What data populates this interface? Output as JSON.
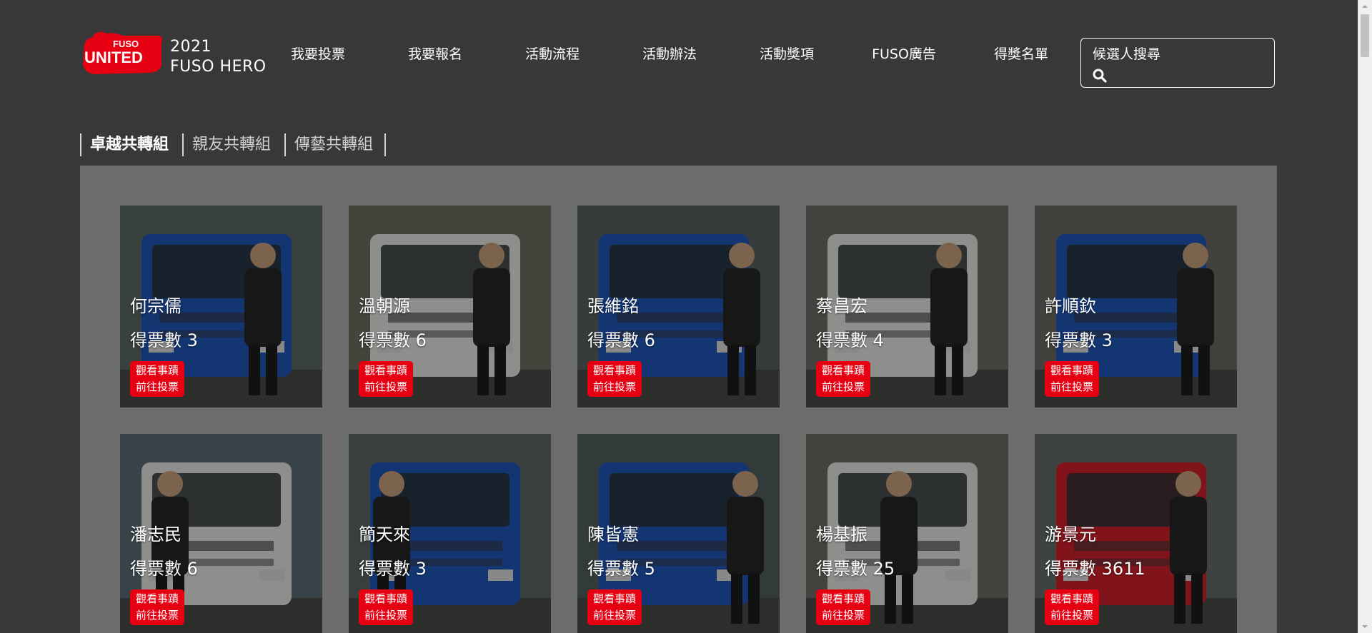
{
  "brand": {
    "logo_top": "FUSO",
    "logo_main": "UNITED",
    "line1": "2021",
    "line2": "FUSO HERO"
  },
  "nav": [
    {
      "label": "我要投票"
    },
    {
      "label": "我要報名"
    },
    {
      "label": "活動流程"
    },
    {
      "label": "活動辦法"
    },
    {
      "label": "活動獎項"
    },
    {
      "label": "FUSO廣告"
    },
    {
      "label": "得獎名單"
    }
  ],
  "search": {
    "label": "候選人搜尋",
    "placeholder": ""
  },
  "tabs": [
    {
      "label": "卓越共轉組",
      "active": true
    },
    {
      "label": "親友共轉組",
      "active": false
    },
    {
      "label": "傳藝共轉組",
      "active": false
    }
  ],
  "buttons": {
    "story": "觀看事蹟",
    "vote": "前往投票"
  },
  "colors": {
    "background": "#383838",
    "panel": "#6c6c6c",
    "accent_red": "#e60012"
  },
  "candidates": [
    {
      "name": "何宗儒",
      "votes": "得票數 3",
      "truck": "blue"
    },
    {
      "name": "溫朝源",
      "votes": "得票數 6",
      "truck": "white"
    },
    {
      "name": "張維銘",
      "votes": "得票數 6",
      "truck": "blue"
    },
    {
      "name": "蔡昌宏",
      "votes": "得票數 4",
      "truck": "white"
    },
    {
      "name": "許順欽",
      "votes": "得票數 3",
      "truck": "blue"
    },
    {
      "name": "潘志民",
      "votes": "得票數 6",
      "truck": "white"
    },
    {
      "name": "簡天來",
      "votes": "得票數 3",
      "truck": "blue"
    },
    {
      "name": "陳皆憲",
      "votes": "得票數 5",
      "truck": "blue"
    },
    {
      "name": "楊基振",
      "votes": "得票數 25",
      "truck": "white"
    },
    {
      "name": "游景元",
      "votes": "得票數 3611",
      "truck": "red"
    }
  ]
}
